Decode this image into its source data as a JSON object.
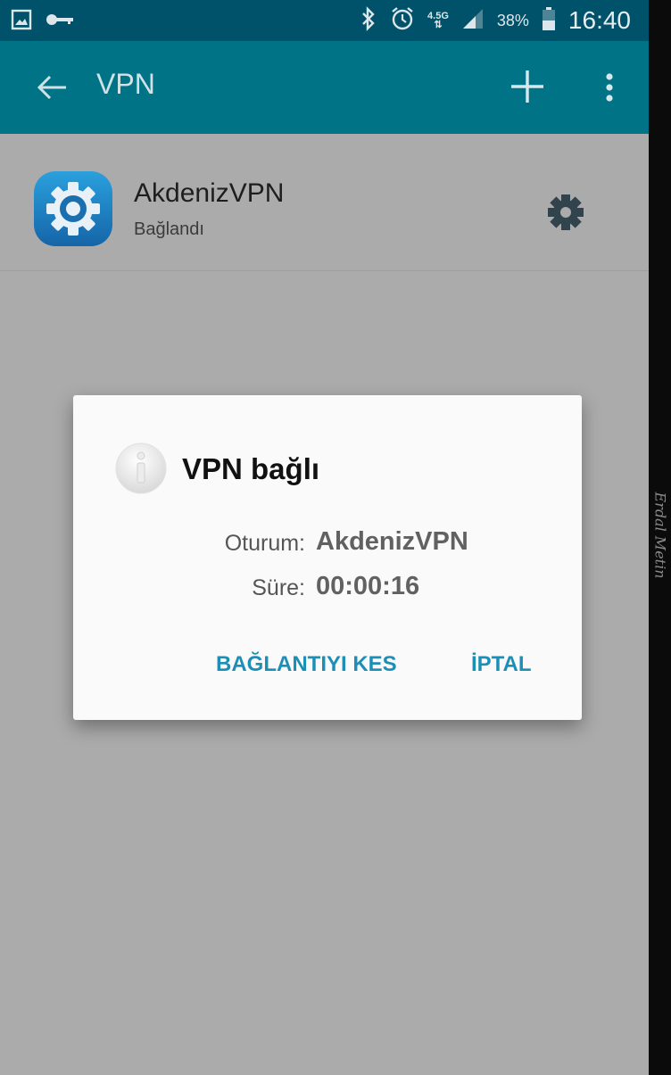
{
  "status_bar": {
    "time": "16:40",
    "battery_percent": "38%",
    "network": "4.5G",
    "icons": [
      "gallery-icon",
      "vpn-key-icon",
      "bluetooth-icon",
      "alarm-icon",
      "signal-icon",
      "battery-icon"
    ]
  },
  "app_bar": {
    "title": "VPN",
    "back_icon": "arrow-left-icon",
    "add_icon": "plus-icon",
    "menu_icon": "more-vert-icon",
    "color": "#007387"
  },
  "vpn_list": [
    {
      "name": "AkdenizVPN",
      "status": "Bağlandı",
      "icon": "settings-app-icon",
      "action_icon": "gear-icon"
    }
  ],
  "dialog": {
    "title": "VPN bağlı",
    "icon": "info-icon",
    "rows": [
      {
        "label": "Oturum:",
        "value": "AkdenizVPN"
      },
      {
        "label": "Süre:",
        "value": "00:00:16"
      }
    ],
    "buttons": {
      "disconnect": "BAĞLANTIYI KES",
      "cancel": "İPTAL"
    },
    "button_color": "#1c8fb6"
  },
  "watermark": "Erdal Metin"
}
